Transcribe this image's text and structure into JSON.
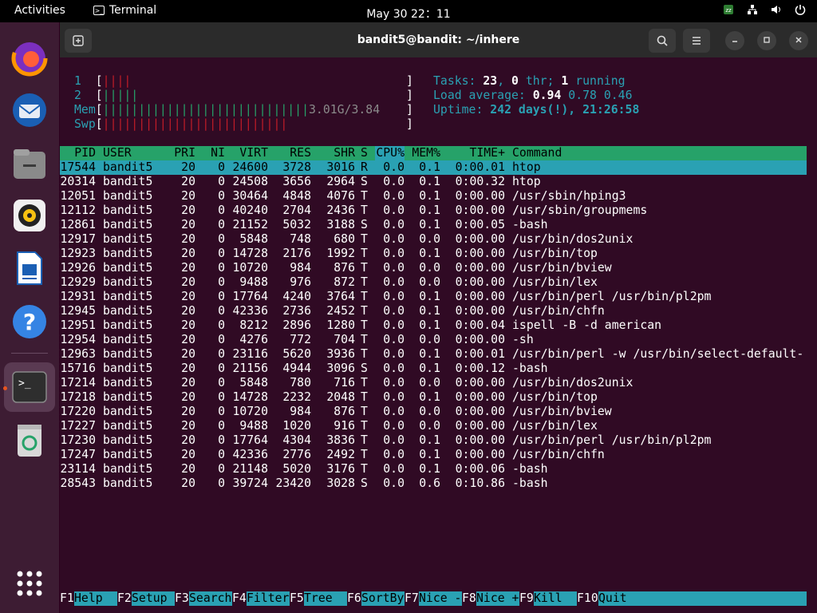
{
  "topbar": {
    "activities": "Activities",
    "app_name": "Terminal",
    "clock": "May 30  22：11"
  },
  "window": {
    "title": "bandit5@bandit: ~/inhere"
  },
  "meters": {
    "cpu1_label": "1",
    "cpu1_bar": "||||",
    "cpu1_pct": "",
    "cpu2_label": "2",
    "cpu2_bar": "|||||",
    "cpu2_pct": "",
    "mem_label": "Mem",
    "mem_bar": "|||||||||||||||||||||||||||||",
    "mem_value": "3.01G/3.84",
    "swp_label": "Swp",
    "swp_bar": "||||||||||||||||||||||||||",
    "swp_value": ""
  },
  "stats": {
    "tasks_label": "Tasks: ",
    "tasks": "23",
    "thr_sep": ", ",
    "thr": "0",
    "thr_label": " thr; ",
    "running": "1",
    "running_label": " running",
    "load_label": "Load average: ",
    "load1": "0.94",
    "load5": "0.78",
    "load15": "0.46",
    "uptime_label": "Uptime: ",
    "uptime": "242 days(!), 21:26:58"
  },
  "table": {
    "headers": [
      "PID",
      "USER",
      "PRI",
      "NI",
      "VIRT",
      "RES",
      "SHR",
      "S",
      "CPU%",
      "MEM%",
      "TIME+",
      "Command"
    ],
    "rows": [
      [
        "17544",
        "bandit5",
        "20",
        "0",
        "24600",
        "3728",
        "3016",
        "R",
        "0.0",
        "0.1",
        "0:00.01",
        "htop"
      ],
      [
        "20314",
        "bandit5",
        "20",
        "0",
        "24508",
        "3656",
        "2964",
        "S",
        "0.0",
        "0.1",
        "0:00.32",
        "htop"
      ],
      [
        "12051",
        "bandit5",
        "20",
        "0",
        "30464",
        "4848",
        "4076",
        "T",
        "0.0",
        "0.1",
        "0:00.00",
        "/usr/sbin/hping3"
      ],
      [
        "12112",
        "bandit5",
        "20",
        "0",
        "40240",
        "2704",
        "2436",
        "T",
        "0.0",
        "0.1",
        "0:00.00",
        "/usr/sbin/groupmems"
      ],
      [
        "12861",
        "bandit5",
        "20",
        "0",
        "21152",
        "5032",
        "3188",
        "S",
        "0.0",
        "0.1",
        "0:00.05",
        "-bash"
      ],
      [
        "12917",
        "bandit5",
        "20",
        "0",
        "5848",
        "748",
        "680",
        "T",
        "0.0",
        "0.0",
        "0:00.00",
        "/usr/bin/dos2unix"
      ],
      [
        "12923",
        "bandit5",
        "20",
        "0",
        "14728",
        "2176",
        "1992",
        "T",
        "0.0",
        "0.1",
        "0:00.00",
        "/usr/bin/top"
      ],
      [
        "12926",
        "bandit5",
        "20",
        "0",
        "10720",
        "984",
        "876",
        "T",
        "0.0",
        "0.0",
        "0:00.00",
        "/usr/bin/bview"
      ],
      [
        "12929",
        "bandit5",
        "20",
        "0",
        "9488",
        "976",
        "872",
        "T",
        "0.0",
        "0.0",
        "0:00.00",
        "/usr/bin/lex"
      ],
      [
        "12931",
        "bandit5",
        "20",
        "0",
        "17764",
        "4240",
        "3764",
        "T",
        "0.0",
        "0.1",
        "0:00.00",
        "/usr/bin/perl /usr/bin/pl2pm"
      ],
      [
        "12945",
        "bandit5",
        "20",
        "0",
        "42336",
        "2736",
        "2452",
        "T",
        "0.0",
        "0.1",
        "0:00.00",
        "/usr/bin/chfn"
      ],
      [
        "12951",
        "bandit5",
        "20",
        "0",
        "8212",
        "2896",
        "1280",
        "T",
        "0.0",
        "0.1",
        "0:00.04",
        "ispell -B -d american"
      ],
      [
        "12954",
        "bandit5",
        "20",
        "0",
        "4276",
        "772",
        "704",
        "T",
        "0.0",
        "0.0",
        "0:00.00",
        "-sh"
      ],
      [
        "12963",
        "bandit5",
        "20",
        "0",
        "23116",
        "5620",
        "3936",
        "T",
        "0.0",
        "0.1",
        "0:00.01",
        "/usr/bin/perl -w /usr/bin/select-default-"
      ],
      [
        "15716",
        "bandit5",
        "20",
        "0",
        "21156",
        "4944",
        "3096",
        "S",
        "0.0",
        "0.1",
        "0:00.12",
        "-bash"
      ],
      [
        "17214",
        "bandit5",
        "20",
        "0",
        "5848",
        "780",
        "716",
        "T",
        "0.0",
        "0.0",
        "0:00.00",
        "/usr/bin/dos2unix"
      ],
      [
        "17218",
        "bandit5",
        "20",
        "0",
        "14728",
        "2232",
        "2048",
        "T",
        "0.0",
        "0.1",
        "0:00.00",
        "/usr/bin/top"
      ],
      [
        "17220",
        "bandit5",
        "20",
        "0",
        "10720",
        "984",
        "876",
        "T",
        "0.0",
        "0.0",
        "0:00.00",
        "/usr/bin/bview"
      ],
      [
        "17227",
        "bandit5",
        "20",
        "0",
        "9488",
        "1020",
        "916",
        "T",
        "0.0",
        "0.0",
        "0:00.00",
        "/usr/bin/lex"
      ],
      [
        "17230",
        "bandit5",
        "20",
        "0",
        "17764",
        "4304",
        "3836",
        "T",
        "0.0",
        "0.1",
        "0:00.00",
        "/usr/bin/perl /usr/bin/pl2pm"
      ],
      [
        "17247",
        "bandit5",
        "20",
        "0",
        "42336",
        "2776",
        "2492",
        "T",
        "0.0",
        "0.1",
        "0:00.00",
        "/usr/bin/chfn"
      ],
      [
        "23114",
        "bandit5",
        "20",
        "0",
        "21148",
        "5020",
        "3176",
        "T",
        "0.0",
        "0.1",
        "0:00.06",
        "-bash"
      ],
      [
        "28543",
        "bandit5",
        "20",
        "0",
        "39724",
        "23420",
        "3028",
        "S",
        "0.0",
        "0.6",
        "0:10.86",
        "-bash"
      ]
    ]
  },
  "fkeys": [
    {
      "key": "F1",
      "label": "Help  "
    },
    {
      "key": "F2",
      "label": "Setup "
    },
    {
      "key": "F3",
      "label": "Search"
    },
    {
      "key": "F4",
      "label": "Filter"
    },
    {
      "key": "F5",
      "label": "Tree  "
    },
    {
      "key": "F6",
      "label": "SortBy"
    },
    {
      "key": "F7",
      "label": "Nice -"
    },
    {
      "key": "F8",
      "label": "Nice +"
    },
    {
      "key": "F9",
      "label": "Kill  "
    },
    {
      "key": "F10",
      "label": "Quit"
    }
  ],
  "colors": {
    "accent": "#e95420",
    "terminal_bg": "#300a24",
    "header_green": "#26a269",
    "select_cyan": "#2aa1b3"
  }
}
